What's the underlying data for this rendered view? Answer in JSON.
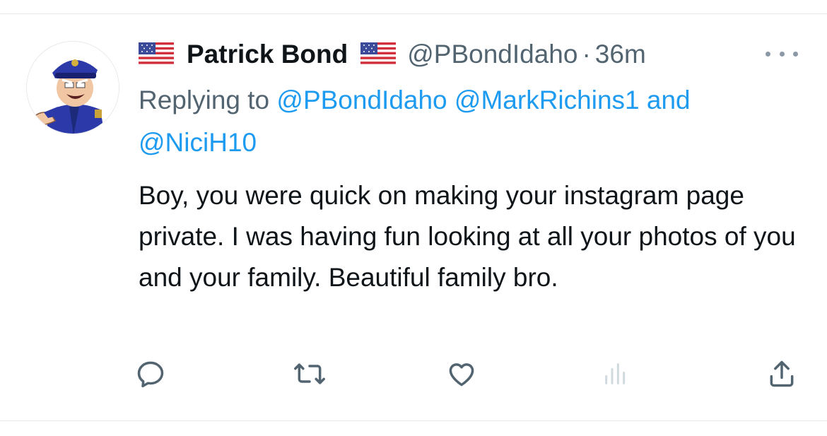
{
  "tweet": {
    "display_name": "Patrick Bond",
    "handle": "@PBondIdaho",
    "separator": "·",
    "time": "36m",
    "reply_prefix": "Replying to",
    "reply_mentions": [
      "@PBondIdaho",
      "@MarkRichins1"
    ],
    "reply_and": "and",
    "reply_last_mention": "@NiciH10",
    "text": "Boy, you were quick on making your instagram page private. I was having fun looking at all your photos of you and your family. Beautiful family bro."
  },
  "icons": {
    "avatar": "cartoon-police-officer-avatar",
    "flag": "us-flag-emoji",
    "more": "more-options-icon",
    "reply": "reply-icon",
    "retweet": "retweet-icon",
    "like": "like-icon",
    "views": "views-icon",
    "share": "share-icon"
  },
  "colors": {
    "text": "#0f1419",
    "secondary": "#536471",
    "link": "#1d9bf0",
    "icon": "#536471",
    "views_icon": "#cfd9de",
    "divider": "#e6e9ea"
  }
}
